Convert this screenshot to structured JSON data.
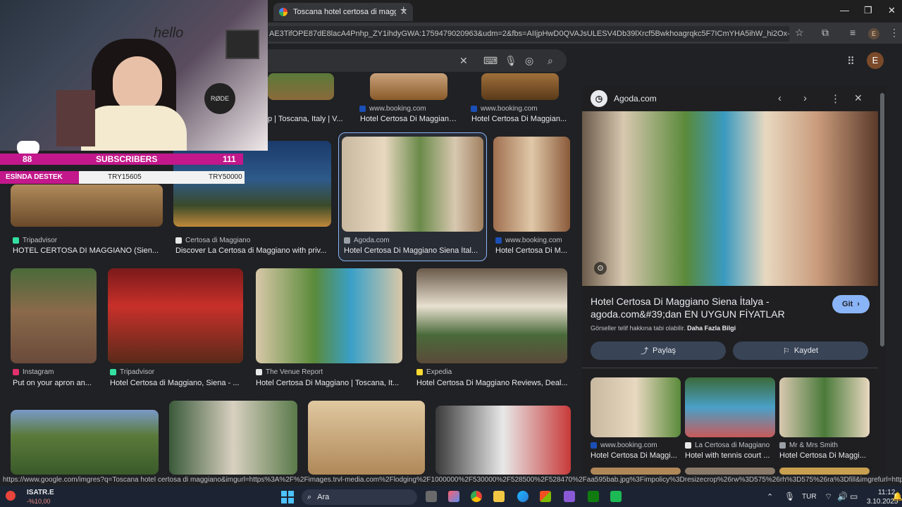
{
  "browser": {
    "tab_title": "Toscana hotel certosa di maggi",
    "tab_close": "✕",
    "new_tab": "+",
    "url": "AE3TifOPE87dE8lacA4Pnhp_ZY1ihdyGWA:1759479020963&udm=2&fbs=AIIjpHwD0QVAJsULESV4Db39lXrcf5Bwkhoagrqkc5F7ICmYHA5ihW_hi2Ox-X7Ynq8f8_I...",
    "profile_letter": "E"
  },
  "search": {
    "clear": "✕",
    "avatar_letter": "E"
  },
  "webcam": {
    "sticker_text": "hello",
    "mic_brand": "RØDE",
    "subs_left": "88",
    "subs_label": "SUBSCRIBERS",
    "subs_right": "111",
    "donate_label": "ESİNDA DESTEK",
    "donate_current": "TRY15605",
    "donate_goal": "TRY50000"
  },
  "results": [
    {
      "source": "",
      "title": "p | Toscana, Italy | V..."
    },
    {
      "source": "www.booking.com",
      "title": "Hotel Certosa Di Maggiano..."
    },
    {
      "source": "www.booking.com",
      "title": "Hotel Certosa Di Maggian..."
    },
    {
      "source": "Tripadvisor",
      "title": "HOTEL CERTOSA DI MAGGIANO (Sien..."
    },
    {
      "source": "Certosa di Maggiano",
      "title": "Discover La Certosa di Maggiano with priv..."
    },
    {
      "source": "Agoda.com",
      "title": "Hotel Certosa Di Maggiano Siena İtal..."
    },
    {
      "source": "www.booking.com",
      "title": "Hotel Certosa Di M..."
    },
    {
      "source": "Instagram",
      "title": "Put on your apron an..."
    },
    {
      "source": "Tripadvisor",
      "title": "Hotel Certosa di Maggiano, Siena - ..."
    },
    {
      "source": "The Venue Report",
      "title": "Hotel Certosa Di Maggiano | Toscana, It..."
    },
    {
      "source": "Expedia",
      "title": "Hotel Certosa Di Maggiano Reviews, Deal..."
    }
  ],
  "panel": {
    "site": "Agoda.com",
    "title_line1": "Hotel Certosa Di Maggiano Siena İtalya -",
    "title_line2": "agoda.com&#39;dan EN UYGUN FİYATLAR",
    "visit_label": "Git",
    "copyright": "Görseller telif hakkına tabi olabilir.",
    "more_info": "Daha Fazla Bilgi",
    "share_label": "Paylaş",
    "save_label": "Kaydet",
    "related": [
      {
        "source": "www.booking.com",
        "title": "Hotel Certosa Di Maggi..."
      },
      {
        "source": "La Certosa di Maggiano",
        "title": "Hotel with tennis court ..."
      },
      {
        "source": "Mr & Mrs Smith",
        "title": "Hotel Certosa Di Maggi..."
      }
    ]
  },
  "status_url": "https://www.google.com/imgres?q=Toscana hotel certosa di maggiano&imgurl=https%3A%2F%2Fimages.trvl-media.com%2Flodging%2F1000000%2F530000%2F528500%2F528470%2Faa595bab.jpg%3Fimpolicy%3Dresizecrop%26rw%3D575%26rh%3D575%26ra%3Dfill&imgrefurl=https%3A%2F%2Fwww.expedia...",
  "taskbar": {
    "stock_name": "ISATR.E",
    "stock_change": "-%10,00",
    "search_label": "Ara",
    "lang": "TUR",
    "time": "11:12",
    "date": "3.10.2025"
  },
  "colors": {
    "accent": "#8ab4f8",
    "panel_button": "#394457",
    "donate_bar": "#c2188b"
  }
}
